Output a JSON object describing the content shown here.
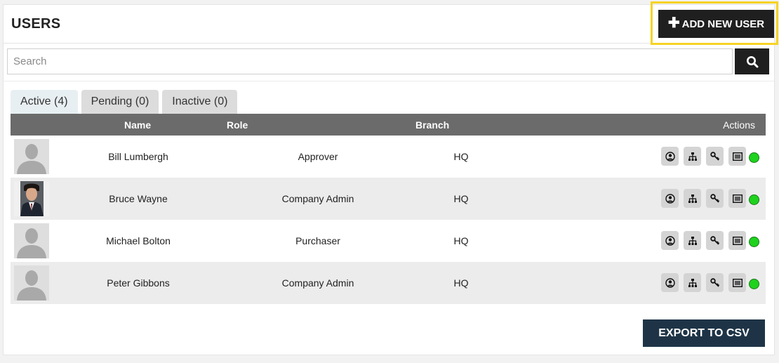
{
  "header": {
    "title": "USERS",
    "add_button_label": "ADD NEW USER",
    "add_button_icon": "plus-icon",
    "highlight_color": "#f6d325"
  },
  "search": {
    "placeholder": "Search",
    "value": "",
    "button_icon": "search-icon"
  },
  "tabs": [
    {
      "label": "Active (4)",
      "active": true
    },
    {
      "label": "Pending (0)",
      "active": false
    },
    {
      "label": "Inactive (0)",
      "active": false
    }
  ],
  "table": {
    "columns": {
      "name": "Name",
      "role": "Role",
      "branch": "Branch",
      "actions": "Actions"
    },
    "rows": [
      {
        "name": "Bill Lumbergh",
        "role": "Approver",
        "branch": "HQ",
        "avatar": "default-avatar",
        "status": "active"
      },
      {
        "name": "Bruce Wayne",
        "role": "Company Admin",
        "branch": "HQ",
        "avatar": "photo-avatar",
        "status": "active"
      },
      {
        "name": "Michael Bolton",
        "role": "Purchaser",
        "branch": "HQ",
        "avatar": "default-avatar",
        "status": "active"
      },
      {
        "name": "Peter Gibbons",
        "role": "Company Admin",
        "branch": "HQ",
        "avatar": "default-avatar",
        "status": "active"
      }
    ],
    "action_icons": [
      "user-profile-icon",
      "org-chart-icon",
      "key-icon",
      "list-icon"
    ],
    "status_color": "#1ed21e"
  },
  "footer": {
    "export_label": "EXPORT TO CSV",
    "export_color": "#1e3446"
  }
}
